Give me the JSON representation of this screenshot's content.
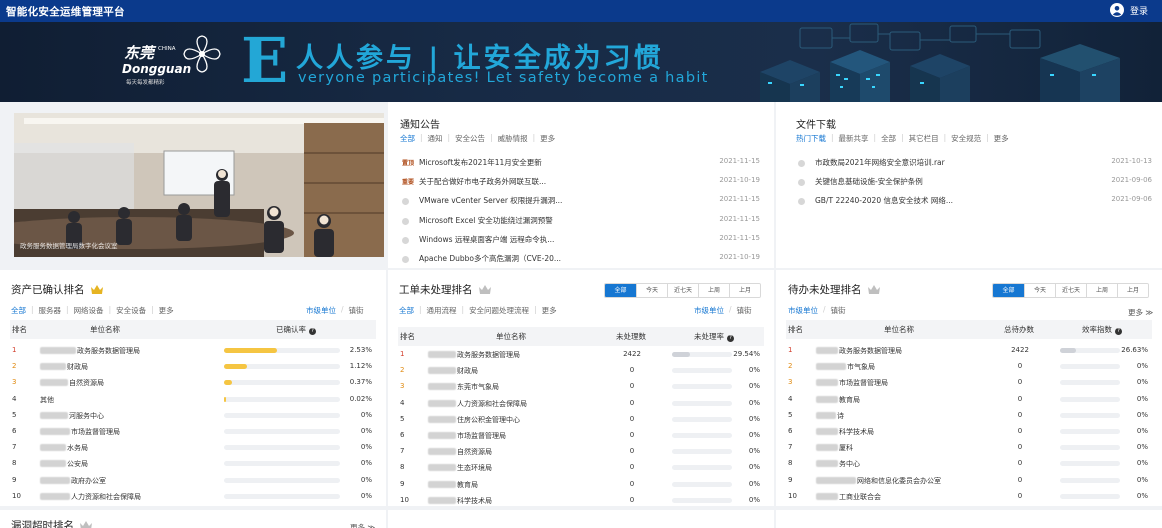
{
  "app_title": "智能化安全运维管理平台",
  "login_label": "登录",
  "banner": {
    "logo_cn": "东莞",
    "logo_china": "CHINA",
    "logo_en": "Dongguan",
    "logo_sub": "每天每发都精彩",
    "big_letter": "E",
    "slogan_cn": "人人参与 | 让安全成为习惯",
    "slogan_en": "veryone participates! Let safety become a habit"
  },
  "photo_caption": "政务服务数据管理局数字化会议室",
  "notice": {
    "title": "通知公告",
    "tabs": [
      "全部",
      "通知",
      "安全公告",
      "威胁情报",
      "更多"
    ],
    "items": [
      {
        "tag": "置顶",
        "text": "Microsoft发布2021年11月安全更新",
        "date": "2021-11-15"
      },
      {
        "tag": "重要",
        "text": "关于配合做好市电子政务外网联互联...",
        "date": "2021-10-19"
      },
      {
        "tag": "",
        "text": "VMware vCenter Server 权限提升漏洞...",
        "date": "2021-11-15"
      },
      {
        "tag": "",
        "text": "Microsoft Excel 安全功能绕过漏洞预警",
        "date": "2021-11-15"
      },
      {
        "tag": "",
        "text": "Windows 远程桌面客户端 远程命令执...",
        "date": "2021-11-15"
      },
      {
        "tag": "",
        "text": "Apache Dubbo多个高危漏洞（CVE-20...",
        "date": "2021-10-19"
      }
    ]
  },
  "files": {
    "title": "文件下载",
    "tabs": [
      "热门下载",
      "最新共享",
      "全部",
      "其它栏目",
      "安全规范",
      "更多"
    ],
    "items": [
      {
        "text": "市政数局2021年网络安全意识培训.rar",
        "date": "2021-10-13"
      },
      {
        "text": "关键信息基础设施-安全保护条例",
        "date": "2021-09-06"
      },
      {
        "text": "GB/T 22240-2020 信息安全技术 网络...",
        "date": "2021-09-06"
      }
    ]
  },
  "assets": {
    "title": "资产已确认排名",
    "tabs": [
      "全部",
      "服务器",
      "网络设备",
      "安全设备",
      "更多"
    ],
    "scope": [
      "市级单位",
      "镇街"
    ],
    "headers": {
      "rank": "排名",
      "unit": "单位名称",
      "rate": "已确认率"
    },
    "rows": [
      {
        "rank": "1",
        "blur": 36,
        "name": "政务服务数据管理局",
        "pct": 2.53,
        "val": "2.53%"
      },
      {
        "rank": "2",
        "blur": 26,
        "name": "财政局",
        "pct": 1.12,
        "val": "1.12%"
      },
      {
        "rank": "3",
        "blur": 28,
        "name": "自然资源局",
        "pct": 0.37,
        "val": "0.37%"
      },
      {
        "rank": "4",
        "blur": 0,
        "name": "其他",
        "pct": 0.02,
        "val": "0.02%"
      },
      {
        "rank": "5",
        "blur": 28,
        "name": "河服务中心",
        "pct": 0,
        "val": "0%"
      },
      {
        "rank": "6",
        "blur": 30,
        "name": "市场监督管理局",
        "pct": 0,
        "val": "0%"
      },
      {
        "rank": "7",
        "blur": 26,
        "name": "水务局",
        "pct": 0,
        "val": "0%"
      },
      {
        "rank": "8",
        "blur": 26,
        "name": "公安局",
        "pct": 0,
        "val": "0%"
      },
      {
        "rank": "9",
        "blur": 30,
        "name": "政府办公室",
        "pct": 0,
        "val": "0%"
      },
      {
        "rank": "10",
        "blur": 30,
        "name": "人力资源和社会保障局",
        "pct": 0,
        "val": "0%"
      }
    ]
  },
  "workorders": {
    "title": "工单未处理排名",
    "tabs": [
      "全部",
      "通用流程",
      "安全问题处理流程",
      "更多"
    ],
    "scope": [
      "市级单位",
      "镇街"
    ],
    "periods": [
      "全部",
      "今天",
      "近七天",
      "上周",
      "上月"
    ],
    "headers": {
      "rank": "排名",
      "unit": "单位名称",
      "count": "未处理数",
      "rate": "未处理率"
    },
    "rows": [
      {
        "rank": "1",
        "blur": 28,
        "name": "政务服务数据管理局",
        "count": "2422",
        "pct": 29.54,
        "val": "29.54%"
      },
      {
        "rank": "2",
        "blur": 28,
        "name": "财政局",
        "count": "0",
        "pct": 0,
        "val": "0%"
      },
      {
        "rank": "3",
        "blur": 28,
        "name": "东莞市气象局",
        "count": "0",
        "pct": 0,
        "val": "0%"
      },
      {
        "rank": "4",
        "blur": 28,
        "name": "人力资源和社会保障局",
        "count": "0",
        "pct": 0,
        "val": "0%"
      },
      {
        "rank": "5",
        "blur": 28,
        "name": "住房公积金管理中心",
        "count": "0",
        "pct": 0,
        "val": "0%"
      },
      {
        "rank": "6",
        "blur": 28,
        "name": "市场监督管理局",
        "count": "0",
        "pct": 0,
        "val": "0%"
      },
      {
        "rank": "7",
        "blur": 28,
        "name": "自然资源局",
        "count": "0",
        "pct": 0,
        "val": "0%"
      },
      {
        "rank": "8",
        "blur": 28,
        "name": "生态环境局",
        "count": "0",
        "pct": 0,
        "val": "0%"
      },
      {
        "rank": "9",
        "blur": 28,
        "name": "教育局",
        "count": "0",
        "pct": 0,
        "val": "0%"
      },
      {
        "rank": "10",
        "blur": 28,
        "name": "科学技术局",
        "count": "0",
        "pct": 0,
        "val": "0%"
      }
    ]
  },
  "todos": {
    "title": "待办未处理排名",
    "scope": [
      "市级单位",
      "镇街"
    ],
    "more": "更多",
    "periods": [
      "全部",
      "今天",
      "近七天",
      "上周",
      "上月"
    ],
    "headers": {
      "rank": "排名",
      "unit": "单位名称",
      "count": "总待办数",
      "rate": "效率指数"
    },
    "rows": [
      {
        "rank": "1",
        "blur": 22,
        "name": "政务服务数据管理局",
        "count": "2422",
        "pct": 26.63,
        "val": "26.63%"
      },
      {
        "rank": "2",
        "blur": 30,
        "name": "市气象局",
        "count": "0",
        "pct": 0,
        "val": "0%"
      },
      {
        "rank": "3",
        "blur": 22,
        "name": "市场监督管理局",
        "count": "0",
        "pct": 0,
        "val": "0%"
      },
      {
        "rank": "4",
        "blur": 22,
        "name": "教育局",
        "count": "0",
        "pct": 0,
        "val": "0%"
      },
      {
        "rank": "5",
        "blur": 20,
        "name": "诗",
        "count": "0",
        "pct": 0,
        "val": "0%"
      },
      {
        "rank": "6",
        "blur": 22,
        "name": "科学技术局",
        "count": "0",
        "pct": 0,
        "val": "0%"
      },
      {
        "rank": "7",
        "blur": 22,
        "name": "厦科",
        "count": "0",
        "pct": 0,
        "val": "0%"
      },
      {
        "rank": "8",
        "blur": 22,
        "name": "务中心",
        "count": "0",
        "pct": 0,
        "val": "0%"
      },
      {
        "rank": "9",
        "blur": 40,
        "name": "网络和信息化委员会办公室",
        "count": "0",
        "pct": 0,
        "val": "0%"
      },
      {
        "rank": "10",
        "blur": 22,
        "name": "工商业联合会",
        "count": "0",
        "pct": 0,
        "val": "0%"
      }
    ]
  },
  "vuln": {
    "title": "漏洞超时排名",
    "more": "更多"
  },
  "colors": {
    "brand": "#0b3a8c",
    "accent": "#1677d2",
    "gold": "#e6b422",
    "orange": "#e08a10"
  }
}
